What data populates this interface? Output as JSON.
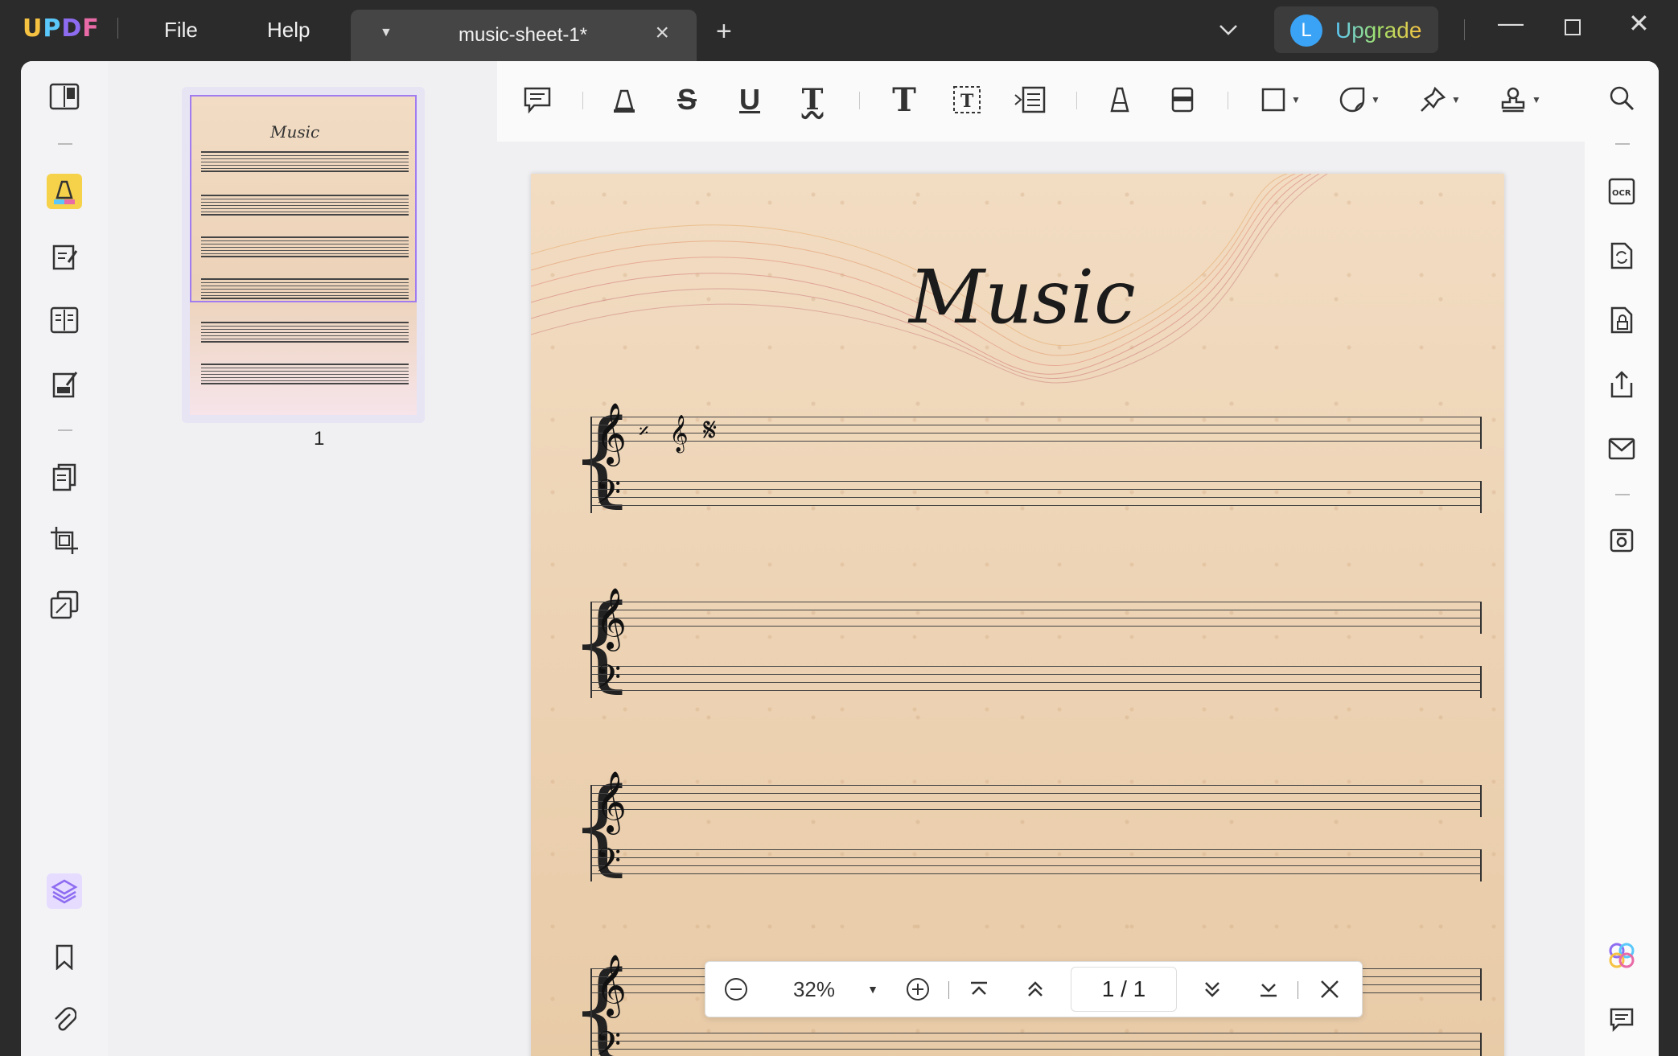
{
  "titlebar": {
    "logo": {
      "u": "U",
      "p": "P",
      "d": "D",
      "f": "F"
    },
    "menu": [
      "File",
      "Help"
    ],
    "tab_title": "music-sheet-1*",
    "upgrade_avatar": "L",
    "upgrade_label": "Upgrade"
  },
  "thumbnails": {
    "page_number": "1",
    "thumb_title": "Music"
  },
  "document": {
    "title": "Music"
  },
  "zoom": {
    "level": "32%",
    "page_indicator": "1 / 1"
  },
  "colors": {
    "accent": "#8e6cf1",
    "highlight_active": "#f6d24a",
    "page_bg": "#ecd3b4"
  },
  "icons": {
    "left_sidebar": [
      "reader-icon",
      "highlight-tool-icon",
      "edit-pdf-icon",
      "page-layout-icon",
      "sign-icon",
      "organize-pages-icon",
      "crop-icon",
      "watermark-icon",
      "layers-icon",
      "bookmark-icon",
      "attachment-icon"
    ],
    "toolbar": [
      "comment-icon",
      "highlighter-icon",
      "strikethrough-icon",
      "underline-icon",
      "squiggly-text-icon",
      "text-icon",
      "text-box-icon",
      "text-callout-icon",
      "pencil-icon",
      "eraser-icon",
      "shape-icon",
      "sticker-icon",
      "pin-icon",
      "stamp-icon"
    ],
    "right_rail": [
      "search-icon",
      "ocr-icon",
      "convert-icon",
      "protect-icon",
      "share-icon",
      "email-icon",
      "save-icon",
      "ai-assistant-icon",
      "comments-panel-icon"
    ]
  }
}
